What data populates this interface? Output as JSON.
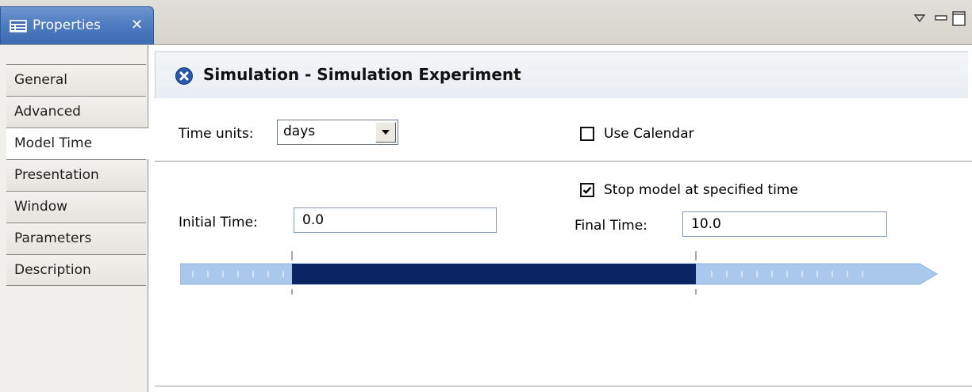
{
  "view": {
    "title": "Properties",
    "icon": "properties-table-icon",
    "close_icon": "close-icon"
  },
  "window_controls": [
    "view-menu-icon",
    "minimize-icon",
    "maximize-icon"
  ],
  "sidebar": {
    "items": [
      {
        "label": "General",
        "active": false
      },
      {
        "label": "Advanced",
        "active": false
      },
      {
        "label": "Model Time",
        "active": true
      },
      {
        "label": "Presentation",
        "active": false
      },
      {
        "label": "Window",
        "active": false
      },
      {
        "label": "Parameters",
        "active": false
      },
      {
        "label": "Description",
        "active": false
      }
    ]
  },
  "header": {
    "icon": "experiment-icon",
    "title": "Simulation - Simulation Experiment"
  },
  "time_units": {
    "label": "Time units:",
    "value": "days"
  },
  "use_calendar": {
    "label": "Use Calendar",
    "checked": false
  },
  "stop_model": {
    "label": "Stop model at specified time",
    "checked": true
  },
  "initial_time": {
    "label": "Initial Time:",
    "value": "0.0"
  },
  "final_time": {
    "label": "Final Time:",
    "value": "10.0"
  },
  "timeline": {
    "start": 0.0,
    "end": 10.0,
    "colors": {
      "outside": "#a9c8ec",
      "range": "#0b2463",
      "tick": "#ffffff"
    }
  }
}
